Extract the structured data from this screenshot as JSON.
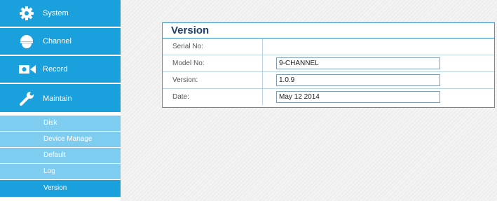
{
  "sidebar": {
    "menu": [
      {
        "label": "System",
        "icon": "gear-icon"
      },
      {
        "label": "Channel",
        "icon": "camera-dome-icon"
      },
      {
        "label": "Record",
        "icon": "video-camera-icon"
      },
      {
        "label": "Maintain",
        "icon": "wrench-icon"
      }
    ],
    "submenu": [
      "Disk",
      "Device Manage",
      "Default",
      "Log",
      "Version"
    ],
    "active_submenu": "Version"
  },
  "panel": {
    "title": "Version",
    "rows": [
      {
        "label": "Serial No:",
        "value": ""
      },
      {
        "label": "Model No:",
        "value": "9-CHANNEL"
      },
      {
        "label": "Version:",
        "value": "1.0.9"
      },
      {
        "label": "Date:",
        "value": "May 12 2014"
      }
    ]
  },
  "colors": {
    "menu_bg": "#1aa0dc",
    "submenu_bg": "#7ecdf0",
    "panel_border": "#3d97c9",
    "title_text": "#1f3f6b"
  }
}
